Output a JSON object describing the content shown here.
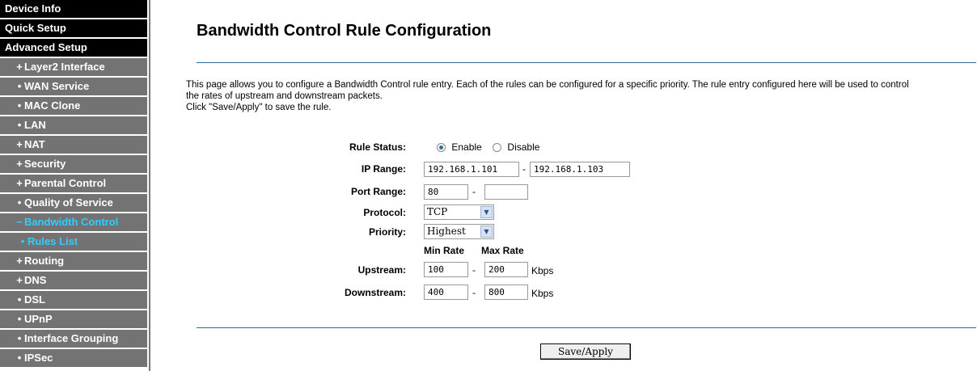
{
  "sidebar": {
    "items": [
      {
        "label": "Device Info",
        "style": "top"
      },
      {
        "label": "Quick Setup",
        "style": "top"
      },
      {
        "label": "Advanced Setup",
        "style": "top"
      },
      {
        "label": "Layer2 Interface",
        "bullet": "+"
      },
      {
        "label": "WAN Service",
        "bullet": "•"
      },
      {
        "label": "MAC Clone",
        "bullet": "•"
      },
      {
        "label": "LAN",
        "bullet": "•"
      },
      {
        "label": "NAT",
        "bullet": "+"
      },
      {
        "label": "Security",
        "bullet": "+"
      },
      {
        "label": "Parental Control",
        "bullet": "+"
      },
      {
        "label": "Quality of Service",
        "bullet": "•"
      },
      {
        "label": "Bandwidth Control",
        "bullet": "−",
        "style": "active"
      },
      {
        "label": "Rules List",
        "bullet": "•",
        "style": "sub"
      },
      {
        "label": "Routing",
        "bullet": "+"
      },
      {
        "label": "DNS",
        "bullet": "+"
      },
      {
        "label": "DSL",
        "bullet": "•"
      },
      {
        "label": "UPnP",
        "bullet": "•"
      },
      {
        "label": "Interface Grouping",
        "bullet": "•"
      },
      {
        "label": "IPSec",
        "bullet": "•"
      }
    ]
  },
  "main": {
    "title": "Bandwidth Control Rule Configuration",
    "description_line1": "This page allows you to configure a Bandwidth Control rule entry. Each of the rules can be configured for a specific priority. The rule entry configured here will be used to control",
    "description_line2": "the rates of upstream and downstream packets.",
    "description_line3": "Click \"Save/Apply\" to save the rule."
  },
  "form": {
    "rule_status_label": "Rule Status:",
    "enable_label": "Enable",
    "disable_label": "Disable",
    "rule_status_value": "Enable",
    "ip_range_label": "IP Range:",
    "ip_start": "192.168.1.101",
    "ip_end": "192.168.1.103",
    "port_range_label": "Port Range:",
    "port_start": "80",
    "port_end": "",
    "protocol_label": "Protocol:",
    "protocol_value": "TCP",
    "priority_label": "Priority:",
    "priority_value": "Highest",
    "min_rate_header": "Min Rate",
    "max_rate_header": "Max Rate",
    "upstream_label": "Upstream:",
    "upstream_min": "100",
    "upstream_max": "200",
    "downstream_label": "Downstream:",
    "downstream_min": "400",
    "downstream_max": "800",
    "unit": "Kbps",
    "dash": "-",
    "save_label": "Save/Apply"
  },
  "colors": {
    "sidebar_item_bg": "#737373",
    "sidebar_top_bg": "#000000",
    "active_text": "#33ccff",
    "rule_line": "#2a6f9f"
  }
}
